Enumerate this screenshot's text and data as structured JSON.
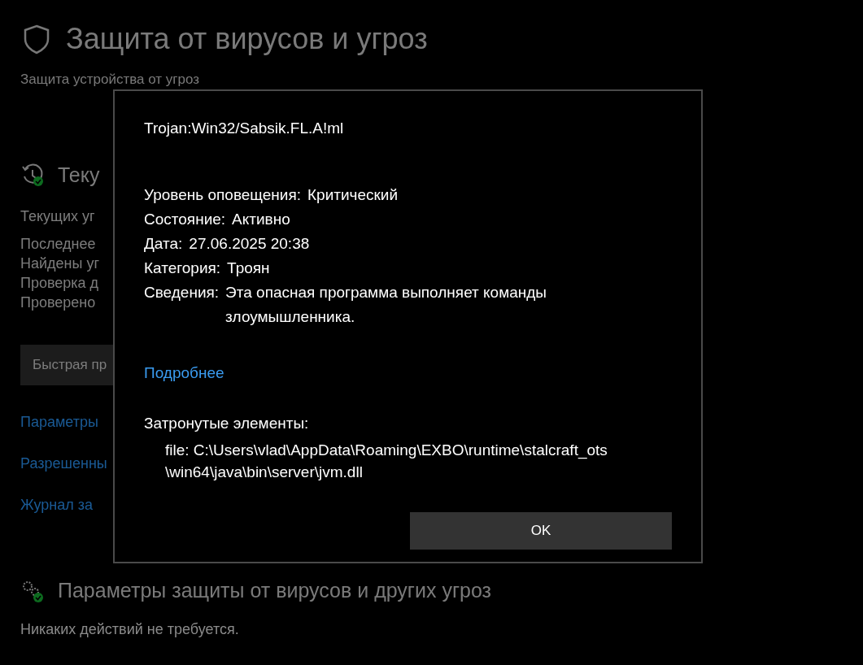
{
  "page": {
    "title": "Защита от вирусов и угроз",
    "subtitle": "Защита устройства от угроз",
    "current_section": {
      "title": "Теку",
      "lines": [
        "Текущих уг",
        "Последнее",
        "Найдены уг",
        "Проверка д",
        "Проверено"
      ],
      "button": "Быстрая пр"
    },
    "links": [
      "Параметры",
      "Разрешенны",
      "Журнал за"
    ],
    "settings_section": {
      "title": "Параметры защиты от вирусов и других угроз",
      "status": "Никаких действий не требуется."
    }
  },
  "dialog": {
    "threat": "Trojan:Win32/Sabsik.FL.A!ml",
    "fields": [
      {
        "label": "Уровень оповещения:",
        "value": "Критический"
      },
      {
        "label": "Состояние:",
        "value": "Активно"
      },
      {
        "label": "Дата:",
        "value": "27.06.2025 20:38"
      },
      {
        "label": "Категория:",
        "value": "Троян"
      },
      {
        "label": "Сведения:",
        "value": "Эта опасная программа выполняет команды злоумышленника."
      }
    ],
    "link": "Подробнее",
    "affected_title": "Затронутые элементы:",
    "affected_items": [
      "file: C:\\Users\\vlad\\AppData\\Roaming\\EXBO\\runtime\\stalcraft_ots\n\\win64\\java\\bin\\server\\jvm.dll"
    ],
    "button": "OK"
  }
}
